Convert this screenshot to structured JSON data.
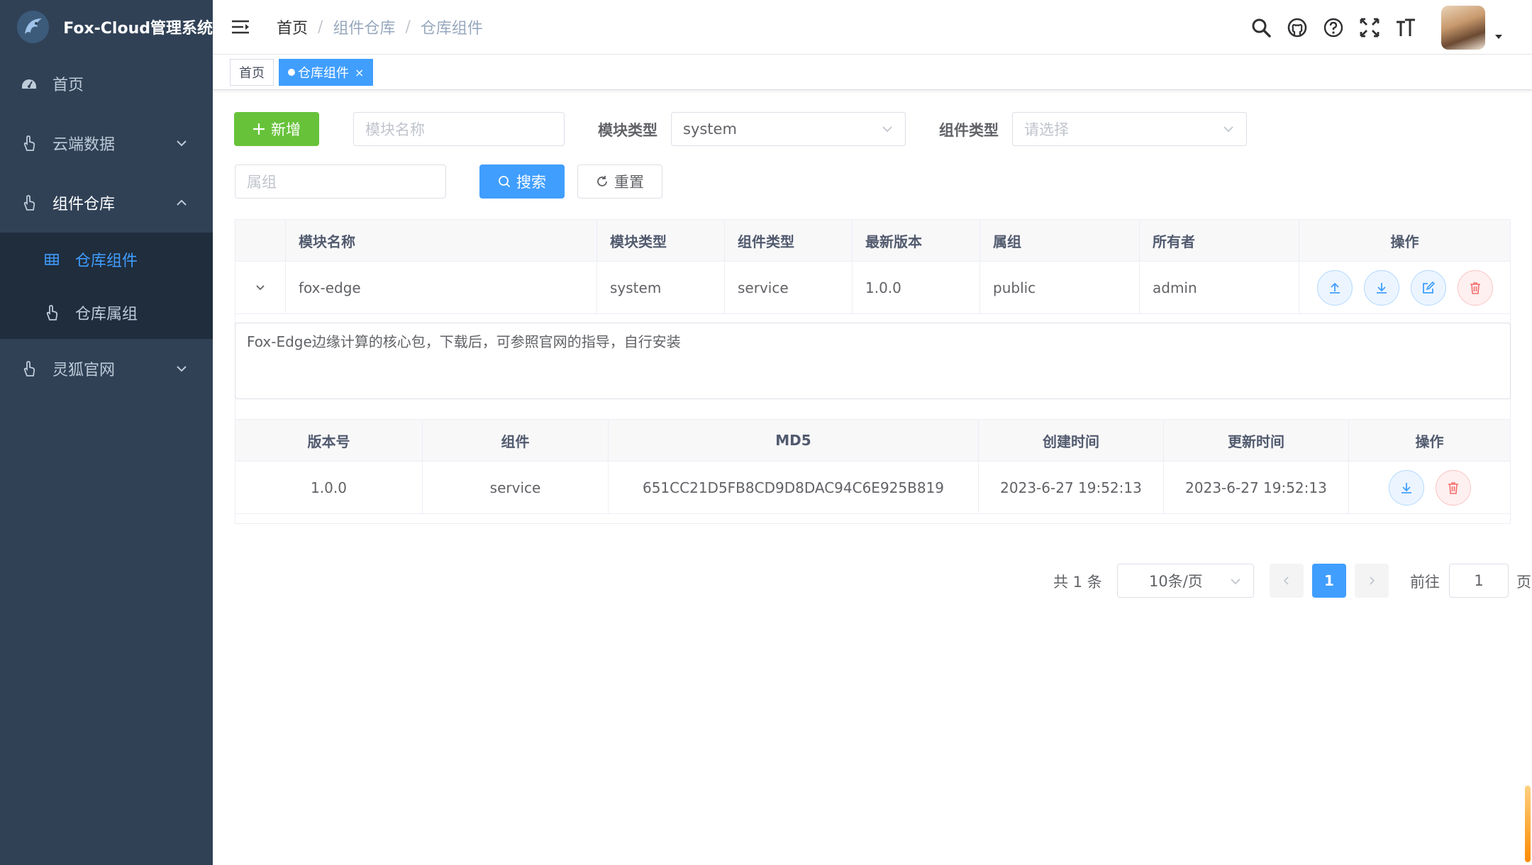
{
  "app": {
    "title": "Fox-Cloud管理系统"
  },
  "sidebar": {
    "items": [
      {
        "label": "首页"
      },
      {
        "label": "云端数据"
      },
      {
        "label": "组件仓库"
      },
      {
        "label": "灵狐官网"
      }
    ],
    "sub_items": [
      {
        "label": "仓库组件",
        "active": true
      },
      {
        "label": "仓库属组"
      }
    ]
  },
  "navbar": {
    "breadcrumb": [
      "首页",
      "组件仓库",
      "仓库组件"
    ],
    "separator": "/",
    "icons": [
      "search-icon",
      "github-icon",
      "help-icon",
      "fullscreen-icon",
      "font-size-icon"
    ]
  },
  "tags": [
    {
      "label": "首页"
    },
    {
      "label": "仓库组件",
      "close": "×"
    }
  ],
  "toolbar": {
    "add_label": "新增",
    "module_name_placeholder": "模块名称",
    "module_type_label": "模块类型",
    "module_type_value": "system",
    "component_type_label": "组件类型",
    "component_type_placeholder": "请选择",
    "group_placeholder": "属组",
    "search_label": "搜索",
    "reset_label": "重置"
  },
  "table": {
    "headers": [
      "模块名称",
      "模块类型",
      "组件类型",
      "最新版本",
      "属组",
      "所有者",
      "操作"
    ],
    "rows": [
      {
        "name": "fox-edge",
        "module_type": "system",
        "component_type": "service",
        "version": "1.0.0",
        "group": "public",
        "owner": "admin"
      }
    ],
    "expanded": {
      "description": "Fox-Edge边缘计算的核心包，下载后，可参照官网的指导，自行安装",
      "headers": [
        "版本号",
        "组件",
        "MD5",
        "创建时间",
        "更新时间",
        "操作"
      ],
      "rows": [
        {
          "version": "1.0.0",
          "component": "service",
          "md5": "651CC21D5FB8CD9D8DAC94C6E925B819",
          "created": "2023-6-27 19:52:13",
          "updated": "2023-6-27 19:52:13"
        }
      ]
    }
  },
  "pagination": {
    "total_text": "共 1 条",
    "page_size": "10条/页",
    "current_page": "1",
    "goto_label": "前往",
    "goto_value": "1",
    "page_suffix": "页"
  },
  "colors": {
    "sidebar_bg": "#304156",
    "submenu_bg": "#1f2d3d",
    "primary": "#409eff",
    "success": "#67c23a",
    "danger": "#f56c6c"
  }
}
